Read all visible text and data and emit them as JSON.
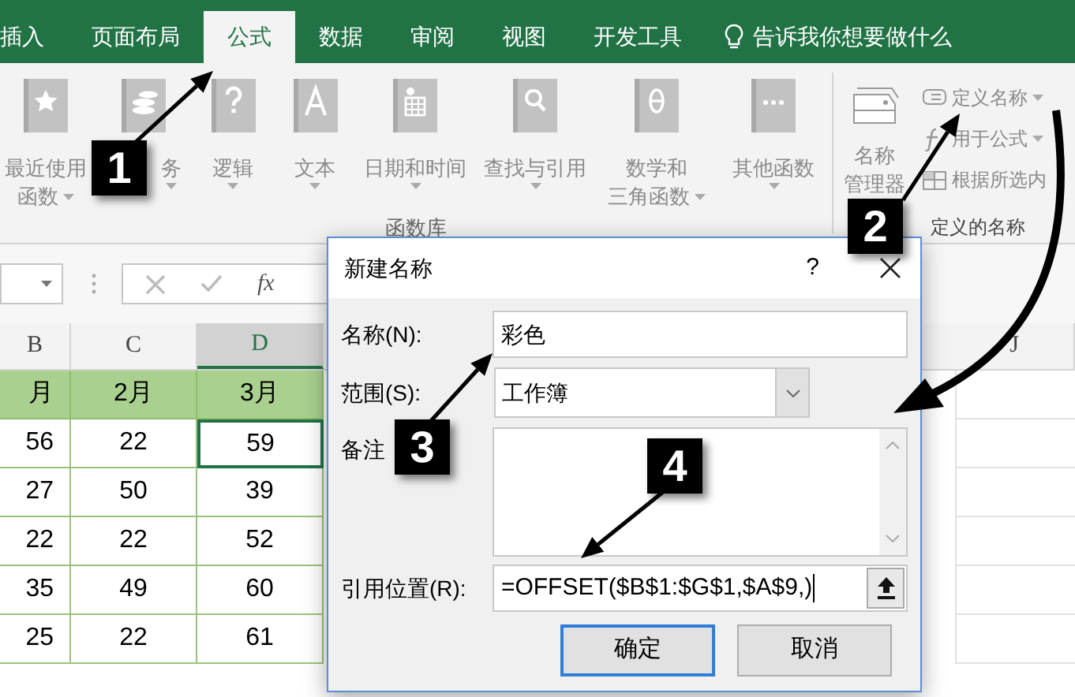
{
  "ribbon_tabs": [
    {
      "label": "插入",
      "selected": false
    },
    {
      "label": "页面布局",
      "selected": false
    },
    {
      "label": "公式",
      "selected": true
    },
    {
      "label": "数据",
      "selected": false
    },
    {
      "label": "审阅",
      "selected": false
    },
    {
      "label": "视图",
      "selected": false
    },
    {
      "label": "开发工具",
      "selected": false
    }
  ],
  "tell_me": "告诉我你想要做什么",
  "function_library": {
    "buttons": [
      {
        "lines": [
          "最近使用",
          "函数"
        ]
      },
      {
        "lines": [
          "务"
        ]
      },
      {
        "lines": [
          "逻辑"
        ]
      },
      {
        "lines": [
          "文本"
        ]
      },
      {
        "lines": [
          "日期和时间"
        ]
      },
      {
        "lines": [
          "查找与引用"
        ]
      },
      {
        "lines": [
          "数学和",
          "三角函数"
        ]
      },
      {
        "lines": [
          "其他函数"
        ]
      }
    ],
    "group_label": "函数库"
  },
  "defined_names": {
    "manager_lines": [
      "名称",
      "管理器"
    ],
    "commands": [
      {
        "label": "定义名称",
        "dropdown": true
      },
      {
        "label": "用于公式",
        "dropdown": true
      },
      {
        "label": "根据所选内",
        "dropdown": false
      }
    ],
    "group_label": "定义的名称"
  },
  "formula_bar": {
    "function_button": "fx"
  },
  "columns": [
    {
      "label": "B",
      "selected": false
    },
    {
      "label": "C",
      "selected": false
    },
    {
      "label": "D",
      "selected": true
    },
    {
      "label": "J",
      "selected": false
    }
  ],
  "rows": [
    {
      "kind": "header",
      "cells": [
        {
          "text": "月",
          "selected": false
        },
        {
          "text": "2月",
          "selected": false
        },
        {
          "text": "3月",
          "selected": false
        }
      ]
    },
    {
      "kind": "data",
      "cells": [
        {
          "text": "56",
          "selected": false
        },
        {
          "text": "22",
          "selected": false
        },
        {
          "text": "59",
          "selected": true
        }
      ]
    },
    {
      "kind": "data",
      "cells": [
        {
          "text": "27",
          "selected": false
        },
        {
          "text": "50",
          "selected": false
        },
        {
          "text": "39",
          "selected": false
        }
      ]
    },
    {
      "kind": "data",
      "cells": [
        {
          "text": "22",
          "selected": false
        },
        {
          "text": "22",
          "selected": false
        },
        {
          "text": "52",
          "selected": false
        }
      ]
    },
    {
      "kind": "data",
      "cells": [
        {
          "text": "35",
          "selected": false
        },
        {
          "text": "49",
          "selected": false
        },
        {
          "text": "60",
          "selected": false
        }
      ]
    },
    {
      "kind": "data",
      "cells": [
        {
          "text": "25",
          "selected": false
        },
        {
          "text": "22",
          "selected": false
        },
        {
          "text": "61",
          "selected": false
        }
      ]
    }
  ],
  "dialog": {
    "title": "新建名称",
    "help": "?",
    "name_label": "名称(N):",
    "name_value": "彩色",
    "scope_label": "范围(S):",
    "scope_value": "工作簿",
    "comment_label": "备注",
    "refers_label": "引用位置(R):",
    "refers_value": "=OFFSET($B$1:$G$1,$A$9,)",
    "ok": "确定",
    "cancel": "取消"
  },
  "annotations": [
    {
      "label": "1"
    },
    {
      "label": "2"
    },
    {
      "label": "3"
    },
    {
      "label": "4"
    }
  ]
}
